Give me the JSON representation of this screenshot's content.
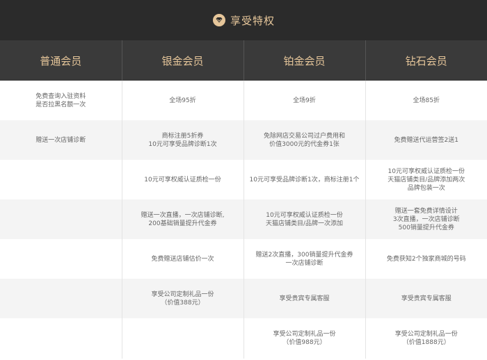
{
  "header": {
    "title": "享受特权",
    "icon": "crown-diamond-icon",
    "accent": "#e6c69a",
    "bg": "#2b2b2b"
  },
  "columns": [
    "普通会员",
    "银金会员",
    "铂金会员",
    "钻石会员"
  ],
  "rows": [
    [
      [
        "免费查询入驻资料",
        "是否拉黑名额一次"
      ],
      [
        "全场95折"
      ],
      [
        "全场9折"
      ],
      [
        "全场85折"
      ]
    ],
    [
      [
        "赠送一次店铺诊断"
      ],
      [
        "商标注册5折券",
        "10元可享受品牌诊断1次"
      ],
      [
        "免除网店交易公司过户费用和",
        "价值3000元的代金券1张"
      ],
      [
        "免费赠送代运营签2送1"
      ]
    ],
    [
      [],
      [
        "10元可享权威认证质检一份"
      ],
      [
        "10元可享受品牌诊断1次，商标注册1个"
      ],
      [
        "10元可享权威认证质检一份",
        "天猫店铺类目/品牌添加两次",
        "品牌包装一次"
      ]
    ],
    [
      [],
      [
        "赠送一次直播，一次店铺诊断,",
        "200基础销量提升代金券"
      ],
      [
        "10元可享权威认证质检一份",
        "天猫店铺类目/品牌一次添加"
      ],
      [
        "赠送一套免费详情设计",
        "3次直播，一次店铺诊断",
        "500销量提升代金券"
      ]
    ],
    [
      [],
      [
        "免费赠送店铺估价一次"
      ],
      [
        "赠送2次直播，300销量提升代金券",
        "一次店铺诊断"
      ],
      [
        "免费获知2个独家商城的号码"
      ]
    ],
    [
      [],
      [
        "享受公司定制礼品一份",
        "（价值388元）"
      ],
      [
        "享受贵宾专属客服"
      ],
      [
        "享受贵宾专属客服"
      ]
    ],
    [
      [],
      [],
      [
        "享受公司定制礼品一份",
        "（价值988元）"
      ],
      [
        "享受公司定制礼品一份",
        "（价值1888元）"
      ]
    ]
  ]
}
